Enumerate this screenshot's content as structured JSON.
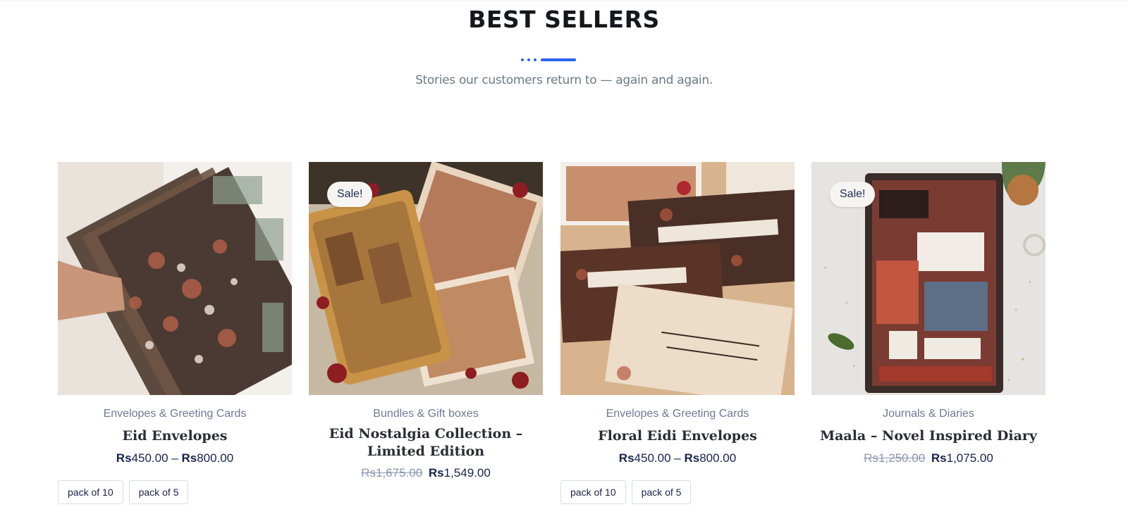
{
  "section": {
    "title": "BEST SELLERS",
    "subtitle": "Stories our customers return to — again and again."
  },
  "colors": {
    "accent": "#2563eb",
    "price": "#17234f",
    "category": "#6d7a96",
    "old_price": "#8a96b2"
  },
  "products": [
    {
      "category": "Envelopes & Greeting Cards",
      "title": "Eid Envelopes",
      "sale_badge": "",
      "price": {
        "currency": "Rs",
        "old": "",
        "min": "450.00",
        "sep": "–",
        "max": "800.00"
      },
      "variants": [
        "pack of 10",
        "pack of 5"
      ]
    },
    {
      "category": "Bundles & Gift boxes",
      "title": "Eid Nostalgia Collection – Limited Edition",
      "sale_badge": "Sale!",
      "price": {
        "currency": "Rs",
        "old": "1,675.00",
        "current": "1,549.00"
      },
      "variants": []
    },
    {
      "category": "Envelopes & Greeting Cards",
      "title": "Floral Eidi Envelopes",
      "sale_badge": "",
      "price": {
        "currency": "Rs",
        "old": "",
        "min": "450.00",
        "sep": "–",
        "max": "800.00"
      },
      "variants": [
        "pack of 10",
        "pack of 5"
      ]
    },
    {
      "category": "Journals & Diaries",
      "title": "Maala – Novel Inspired Diary",
      "sale_badge": "Sale!",
      "price": {
        "currency": "Rs",
        "old": "1,250.00",
        "current": "1,075.00"
      },
      "variants": []
    }
  ]
}
